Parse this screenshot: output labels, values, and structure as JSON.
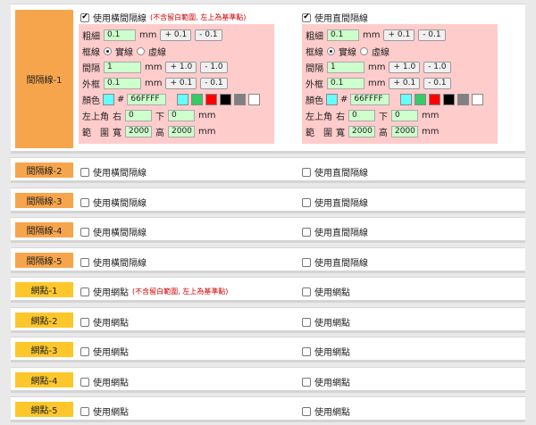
{
  "first": {
    "label": "間隔線-1",
    "h_label": "使用橫間隔線",
    "h_note": "(不含留白範圍, 左上為基準點)",
    "v_label": "使用直間隔線",
    "thickness_label": "粗細",
    "thickness_value": "0.1",
    "frame_label": "框線",
    "solid_label": "實線",
    "dashed_label": "虛線",
    "spacing_label": "間隔",
    "spacing_value": "1",
    "outer_label": "外框",
    "outer_value": "0.1",
    "color_label": "顏色",
    "color_value": "66FFFF",
    "hash": "#",
    "topleft_label": "左上角",
    "right_label": "右",
    "right_value": "0",
    "down_label": "下",
    "down_value": "0",
    "range_label": "範　圍",
    "width_label": "寬",
    "width_value": "2000",
    "height_label": "高",
    "height_value": "2000",
    "unit": "mm",
    "plus_01": "+ 0.1",
    "minus_01": "- 0.1",
    "plus_10": "+ 1.0",
    "minus_10": "- 1.0",
    "swatches": [
      "#66ffff",
      "#33cc66",
      "#ff0000",
      "#000000",
      "#808080",
      "#ffffff"
    ],
    "preview_color": "#66ffff"
  },
  "rows": [
    {
      "label": "間隔線-2",
      "left": "使用橫間隔線",
      "right": "使用直間隔線",
      "color": "orange"
    },
    {
      "label": "間隔線-3",
      "left": "使用橫間隔線",
      "right": "使用直間隔線",
      "color": "orange"
    },
    {
      "label": "間隔線-4",
      "left": "使用橫間隔線",
      "right": "使用直間隔線",
      "color": "orange"
    },
    {
      "label": "間隔線-5",
      "left": "使用橫間隔線",
      "right": "使用直間隔線",
      "color": "orange"
    },
    {
      "label": "網點-1",
      "left": "使用網點",
      "left_note": "(不含留白範圍, 左上為基準點)",
      "right": "使用網點",
      "color": "yellow"
    },
    {
      "label": "網點-2",
      "left": "使用網點",
      "right": "使用網點",
      "color": "yellow"
    },
    {
      "label": "網點-3",
      "left": "使用網點",
      "right": "使用網點",
      "color": "yellow"
    },
    {
      "label": "網點-4",
      "left": "使用網點",
      "right": "使用網點",
      "color": "yellow"
    },
    {
      "label": "網點-5",
      "left": "使用網點",
      "right": "使用網點",
      "color": "yellow"
    }
  ],
  "checked_mark": "✔"
}
